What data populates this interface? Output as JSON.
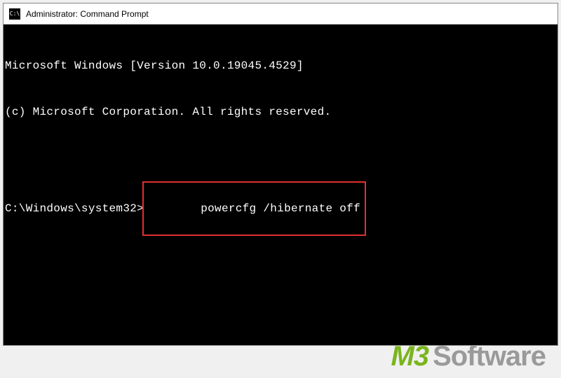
{
  "titlebar": {
    "icon_glyph": "C:\\",
    "title": "Administrator: Command Prompt"
  },
  "terminal": {
    "line1": "Microsoft Windows [Version 10.0.19045.4529]",
    "line2": "(c) Microsoft Corporation. All rights reserved.",
    "blank": "",
    "prompt": "C:\\Windows\\system32>",
    "command": "powercfg /hibernate off"
  },
  "highlight": {
    "color": "#e03030"
  },
  "watermark": {
    "part1": "M3",
    "part2": "Software"
  }
}
